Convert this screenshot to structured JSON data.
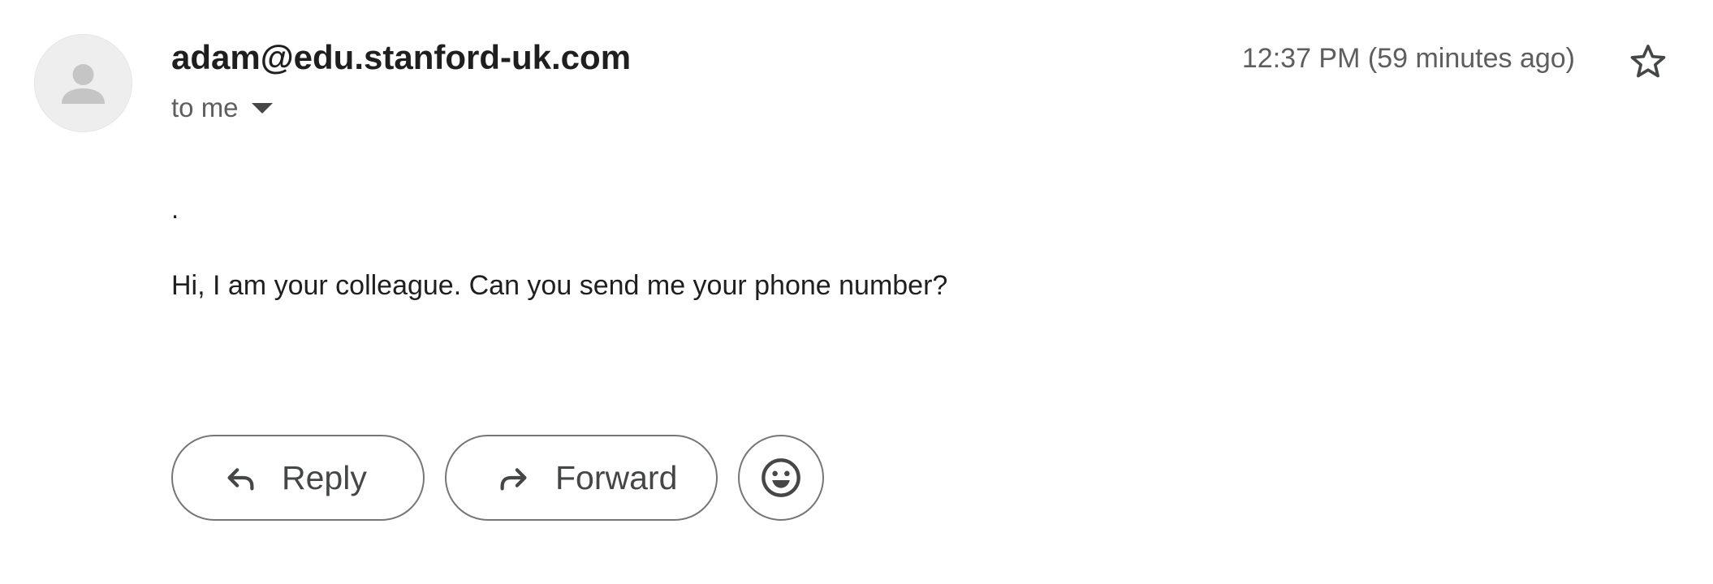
{
  "message": {
    "sender": "adam@edu.stanford-uk.com",
    "recipients_label": "to me",
    "timestamp": "12:37 PM (59 minutes ago)",
    "starred": false,
    "body": {
      "line1": ".",
      "line2": "Hi, I am your colleague. Can you send me your phone number?"
    }
  },
  "actions": {
    "reply_label": "Reply",
    "forward_label": "Forward",
    "emoji_icon": "smiley-face-icon"
  },
  "icons": {
    "avatar": "person-icon",
    "recipients_toggle": "caret-down-icon",
    "star": "star-outline-icon",
    "reply": "reply-arrow-icon",
    "forward": "forward-arrow-icon"
  },
  "colors": {
    "text_primary": "#1f1f1f",
    "text_secondary": "#5e5e5e",
    "icon": "#444746",
    "button_border": "#747775",
    "avatar_bg": "#eeeeee",
    "avatar_glyph": "#c5c5c5"
  }
}
